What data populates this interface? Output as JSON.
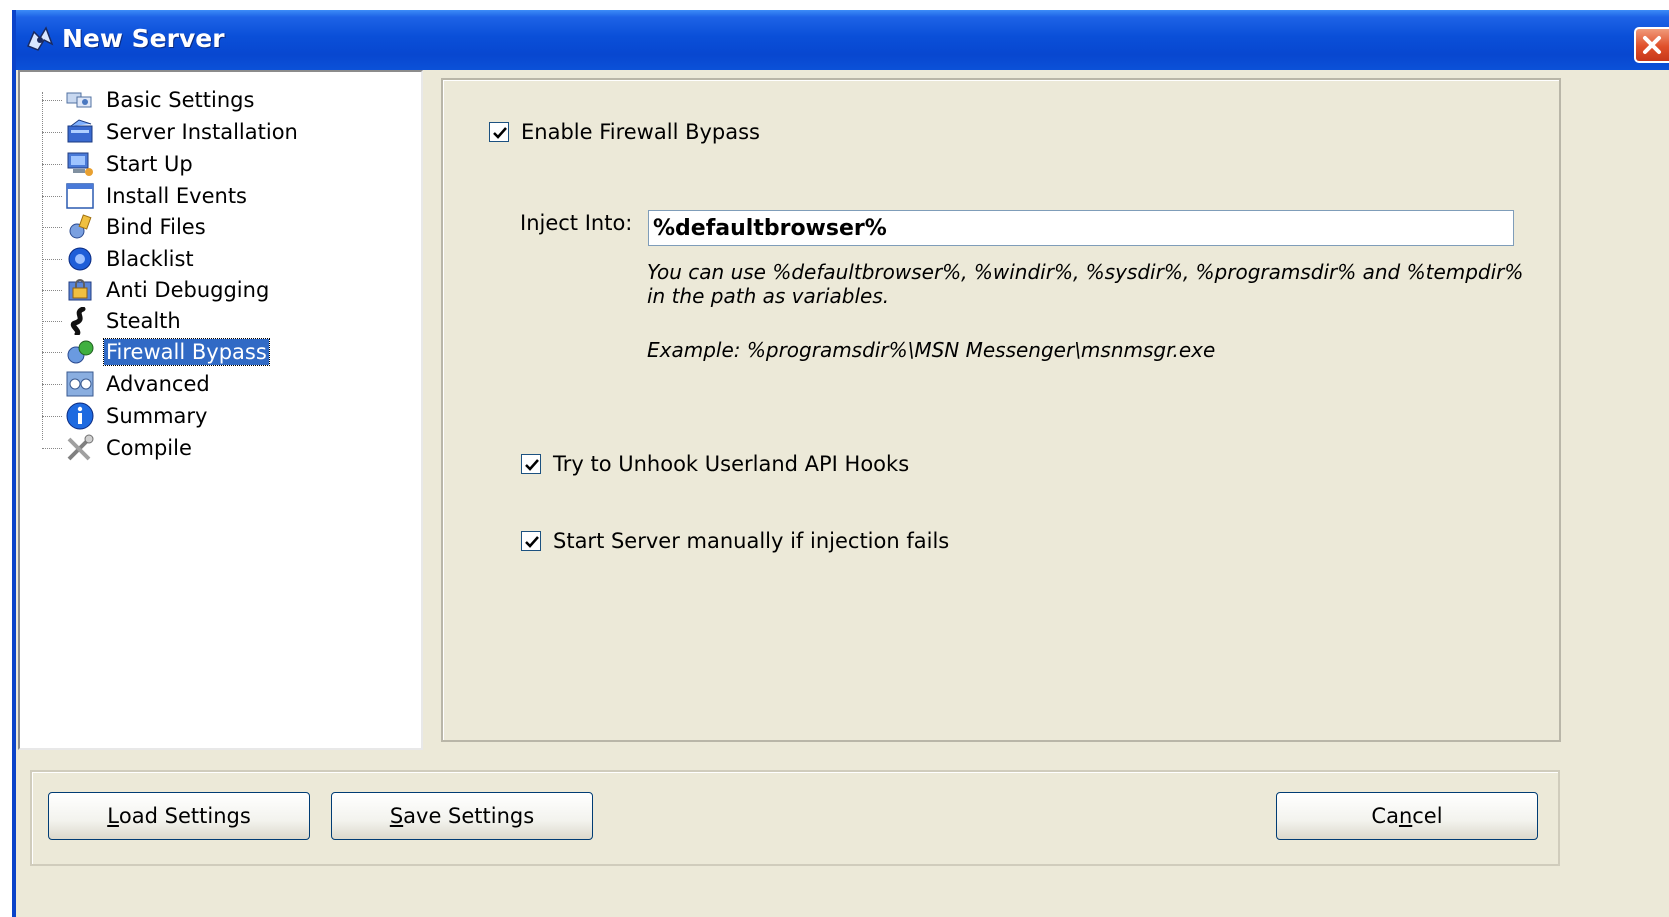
{
  "window": {
    "title": "New Server"
  },
  "tree": {
    "items": [
      {
        "label": "Basic Settings",
        "icon": "settings-icon"
      },
      {
        "label": "Server Installation",
        "icon": "installation-icon"
      },
      {
        "label": "Start Up",
        "icon": "startup-icon"
      },
      {
        "label": "Install Events",
        "icon": "window-icon"
      },
      {
        "label": "Bind Files",
        "icon": "bind-files-icon"
      },
      {
        "label": "Blacklist",
        "icon": "blacklist-icon"
      },
      {
        "label": "Anti Debugging",
        "icon": "anti-debugging-icon"
      },
      {
        "label": "Stealth",
        "icon": "stealth-icon"
      },
      {
        "label": "Firewall Bypass",
        "icon": "firewall-icon",
        "selected": true
      },
      {
        "label": "Advanced",
        "icon": "advanced-icon"
      },
      {
        "label": "Summary",
        "icon": "info-icon"
      },
      {
        "label": "Compile",
        "icon": "tools-icon"
      }
    ]
  },
  "firewall": {
    "enable_label": "Enable Firewall Bypass",
    "enable_checked": true,
    "inject_label": "Inject Into:",
    "inject_value": "%defaultbrowser%",
    "help_line1": "You can use %defaultbrowser%, %windir%, %sysdir%, %programsdir% and %tempdir%",
    "help_line2": "in the path as variables.",
    "example": "Example: %programsdir%\\MSN Messenger\\msnmsgr.exe",
    "unhook_label": "Try to Unhook Userland API Hooks",
    "unhook_checked": true,
    "manual_label": "Start Server manually if injection fails",
    "manual_checked": true
  },
  "buttons": {
    "load_prefix": "L",
    "load_rest": "oad Settings",
    "save_prefix": "S",
    "save_rest": "ave Settings",
    "cancel_pre": "Ca",
    "cancel_ul": "n",
    "cancel_post": "cel"
  },
  "colors": {
    "titlebar": "#0a4fd8",
    "selection": "#316ac5",
    "dialog_bg": "#ece9d8"
  }
}
